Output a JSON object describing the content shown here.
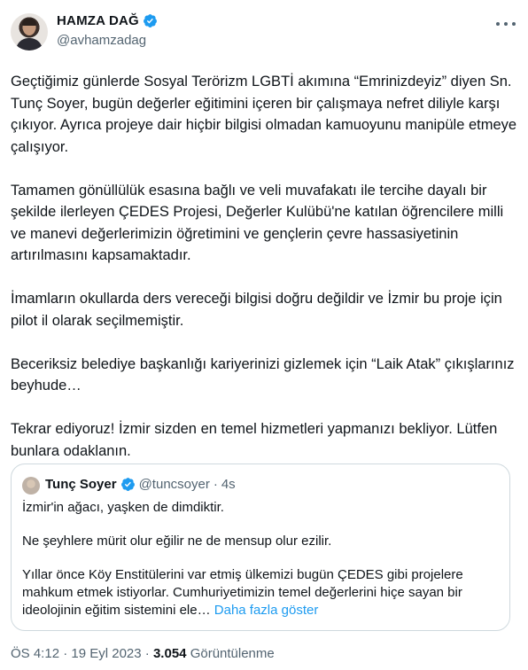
{
  "author": {
    "name": "HAMZA DAĞ",
    "handle": "@avhamzadag",
    "verified": true,
    "avatar_icon": "profile-photo"
  },
  "tweet": {
    "paragraphs": [
      "Geçtiğimiz günlerde Sosyal Terörizm LGBTİ akımına “Emrinizdeyiz” diyen Sn. Tunç Soyer, bugün değerler eğitimini içeren bir çalışmaya nefret diliyle karşı çıkıyor. Ayrıca projeye dair hiçbir bilgisi olmadan kamuoyunu manipüle etmeye çalışıyor.",
      "Tamamen gönüllülük esasına bağlı ve veli muvafakatı ile tercihe dayalı bir şekilde ilerleyen ÇEDES Projesi, Değerler Kulübü'ne katılan öğrencilere milli ve manevi değerlerimizin öğretimini ve gençlerin çevre hassasiyetinin artırılmasını kapsamaktadır.",
      "İmamların okullarda ders vereceği bilgisi doğru değildir ve İzmir bu proje için pilot il olarak seçilmemiştir.",
      "Beceriksiz belediye başkanlığı kariyerinizi gizlemek için “Laik Atak” çıkışlarınız beyhude…",
      "Tekrar ediyoruz! İzmir sizden en temel hizmetleri yapmanızı bekliyor. Lütfen bunlara odaklanın."
    ]
  },
  "quoted": {
    "name": "Tunç Soyer",
    "handle": "@tuncsoyer",
    "separator": "·",
    "time": "4s",
    "paragraphs": [
      "İzmir'in ağacı, yaşken de dimdiktir.",
      "Ne şeyhlere mürit olur eğilir ne de mensup olur ezilir.",
      "Yıllar önce Köy Enstitülerini var etmiş ülkemizi bugün ÇEDES gibi projelere mahkum etmek istiyorlar. Cumhuriyetimizin temel değerlerini hiçe sayan bir ideolojinin eğitim sistemini ele…"
    ],
    "show_more": "Daha fazla göster"
  },
  "footer": {
    "time": "ÖS 4:12",
    "separator": "·",
    "date": "19 Eyl 2023",
    "views_count": "3.054",
    "views_label": "Görüntülenme"
  },
  "colors": {
    "verified": "#1d9bf0",
    "link": "#1d9bf0",
    "secondary_text": "#536471",
    "border": "#cfd9de"
  }
}
